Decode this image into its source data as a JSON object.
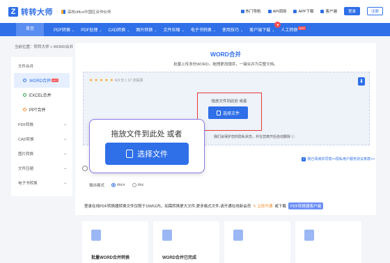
{
  "header": {
    "logo_mark": "Z",
    "logo_text": "转转大师",
    "partner": "高校office中国区合作伙伴",
    "links": [
      "热门导航",
      "API调用",
      "APP下载",
      "客户端"
    ],
    "login": "登录",
    "register": "注册"
  },
  "nav": {
    "home": "首页",
    "items": [
      "PDF转换",
      "PDF处理",
      "CAD转换",
      "图片转换",
      "文件压缩",
      "电子书转换",
      "使用技巧",
      "客户端下载"
    ],
    "ai": "人工转换",
    "hot_badge": "",
    "ai_badge": "HOT"
  },
  "breadcrumb": "当前位置：转转大师 > WORD合并",
  "sidebar": {
    "group": "文件合并",
    "subitems": [
      {
        "label": "WORD合并",
        "badge": "HOT"
      },
      {
        "label": "EXCEL合并"
      },
      {
        "label": "PPT合并"
      }
    ],
    "categories": [
      "PDF转换",
      "CAD转换",
      "图片转换",
      "文件压缩",
      "电子书转换"
    ]
  },
  "main": {
    "title": "WORD合并",
    "subtitle": "批量上传多份WORD，拖拽更改顺序，一键合并为完整文档。",
    "rating_score": "4.9 分",
    "rating_count": "17 次投票",
    "stars": 5,
    "drop_hint": "拖放文件到此处 或者",
    "choose_button": "选择文件",
    "privacy": "我们会保护您的隐私状态，并在您离开后自动删除 ⓘ",
    "notify": "我已阅读并同意<<隐私用户服务协议条款>>",
    "format_label": "输出格式",
    "formats": [
      "docx",
      "doc"
    ]
  },
  "zoom": {
    "hint": "拖放文件到此处 或者",
    "button": "选择文件"
  },
  "promo": {
    "text": "登录在线PDF转换器转换文件仅限于15M以内，如需转换更大文件,更多格式文件,请开通在线新会员",
    "open": "立即开通",
    "or": "或下载",
    "client": "PDF转换器客户端"
  },
  "cards": [
    {
      "label": "批量WORD合并转换"
    },
    {
      "label": "WORD合并已完成"
    },
    {
      "label": ""
    },
    {
      "label": ""
    }
  ]
}
